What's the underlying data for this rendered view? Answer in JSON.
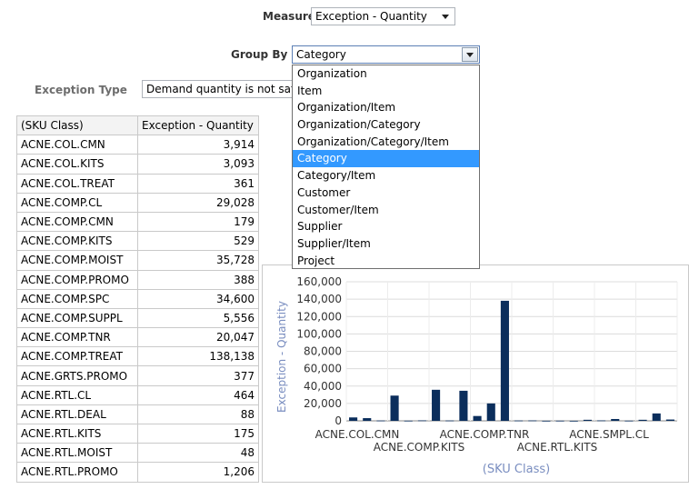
{
  "measure": {
    "label": "Measure",
    "value": "Exception - Quantity"
  },
  "group_by": {
    "label": "Group By",
    "value": "Category",
    "options": [
      "Organization",
      "Item",
      "Organization/Item",
      "Organization/Category",
      "Organization/Category/Item",
      "Category",
      "Category/Item",
      "Customer",
      "Customer/Item",
      "Supplier",
      "Supplier/Item",
      "Project"
    ],
    "selected_index": 5
  },
  "exception_type": {
    "label": "Exception Type",
    "value": "Demand quantity is not sat"
  },
  "table": {
    "headers": [
      "(SKU Class)",
      "Exception - Quantity"
    ],
    "rows": [
      [
        "ACNE.COL.CMN",
        "3,914"
      ],
      [
        "ACNE.COL.KITS",
        "3,093"
      ],
      [
        "ACNE.COL.TREAT",
        "361"
      ],
      [
        "ACNE.COMP.CL",
        "29,028"
      ],
      [
        "ACNE.COMP.CMN",
        "179"
      ],
      [
        "ACNE.COMP.KITS",
        "529"
      ],
      [
        "ACNE.COMP.MOIST",
        "35,728"
      ],
      [
        "ACNE.COMP.PROMO",
        "388"
      ],
      [
        "ACNE.COMP.SPC",
        "34,600"
      ],
      [
        "ACNE.COMP.SUPPL",
        "5,556"
      ],
      [
        "ACNE.COMP.TNR",
        "20,047"
      ],
      [
        "ACNE.COMP.TREAT",
        "138,138"
      ],
      [
        "ACNE.GRTS.PROMO",
        "377"
      ],
      [
        "ACNE.RTL.CL",
        "464"
      ],
      [
        "ACNE.RTL.DEAL",
        "88"
      ],
      [
        "ACNE.RTL.KITS",
        "175"
      ],
      [
        "ACNE.RTL.MOIST",
        "48"
      ],
      [
        "ACNE.RTL.PROMO",
        "1,206"
      ]
    ]
  },
  "chart_data": {
    "type": "bar",
    "xlabel": "(SKU Class)",
    "ylabel": "Exception - Quantity",
    "ylim": [
      0,
      160000
    ],
    "yticks": [
      "0",
      "20,000",
      "40,000",
      "60,000",
      "80,000",
      "100,000",
      "120,000",
      "140,000",
      "160,000"
    ],
    "tick_labels_row1": [
      "ACNE.COL.CMN",
      "ACNE.COMP.TNR",
      "ACNE.SMPL.CL"
    ],
    "tick_labels_row2": [
      "ACNE.COMP.KITS",
      "ACNE.RTL.KITS"
    ],
    "values": [
      3914,
      3093,
      361,
      29028,
      179,
      529,
      35728,
      388,
      34600,
      5556,
      20047,
      138138,
      377,
      464,
      88,
      175,
      48,
      1206,
      500,
      2100,
      200,
      1200,
      8500,
      1500
    ],
    "bar_color": "#0b2e5c",
    "grid": true
  }
}
